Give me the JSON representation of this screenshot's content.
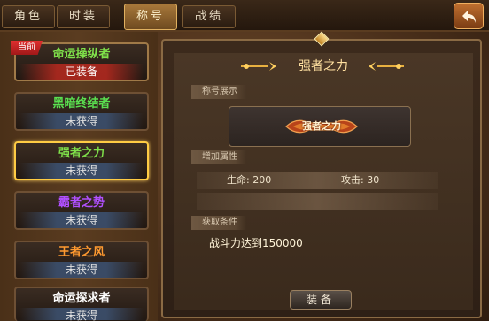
{
  "tabs": [
    {
      "label": "角色",
      "active": false
    },
    {
      "label": "时装",
      "active": false
    },
    {
      "label": "称号",
      "active": true
    },
    {
      "label": "战绩",
      "active": false
    }
  ],
  "current_badge": "当前",
  "titles": [
    {
      "name": "命运操纵者",
      "state": "已装备",
      "name_color": "#7fe04a"
    },
    {
      "name": "黑暗终结者",
      "state": "未获得",
      "name_color": "#5ae050"
    },
    {
      "name": "强者之力",
      "state": "未获得",
      "name_color": "#7fe04a"
    },
    {
      "name": "霸者之势",
      "state": "未获得",
      "name_color": "#b050ff"
    },
    {
      "name": "王者之风",
      "state": "未获得",
      "name_color": "#ff9a30"
    },
    {
      "name": "命运探求者",
      "state": "未获得",
      "name_color": "#ffffff"
    }
  ],
  "detail": {
    "heading": "强者之力",
    "badge_section": "称号展示",
    "badge_art_text": "强者之力",
    "attr_section": "增加属性",
    "attr_hp": "生命: 200",
    "attr_atk": "攻击: 30",
    "cond_section": "获取条件",
    "condition": "战斗力达到150000",
    "equip_label": "装备"
  },
  "icons": {
    "back": "back-arrow-icon",
    "gem": "diamond-icon",
    "ornament": "ornament-icon"
  }
}
